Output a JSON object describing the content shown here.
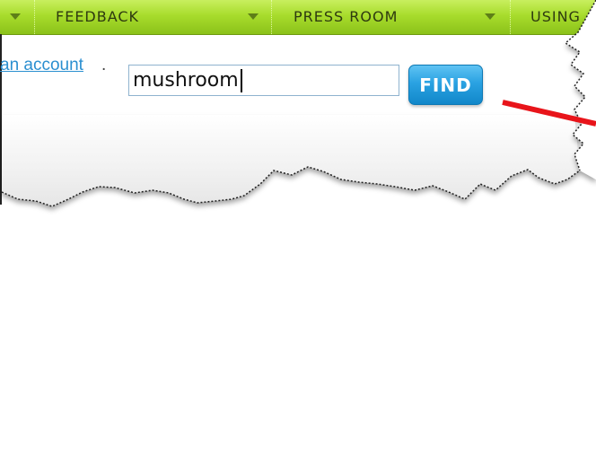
{
  "nav": {
    "items": [
      {
        "label": "FEEDBACK"
      },
      {
        "label": "PRESS ROOM"
      },
      {
        "label": "USING"
      }
    ]
  },
  "account_link": "an account",
  "account_period": ".",
  "search": {
    "value": "mushroom",
    "button_label": "FIND"
  },
  "colors": {
    "nav_green": "#a8dc2c",
    "link_blue": "#2b8fd0",
    "button_blue": "#2aa2e2",
    "annotation_red": "#e8141a"
  },
  "icons": [
    "caret-down-icon",
    "annotation-arrow"
  ]
}
